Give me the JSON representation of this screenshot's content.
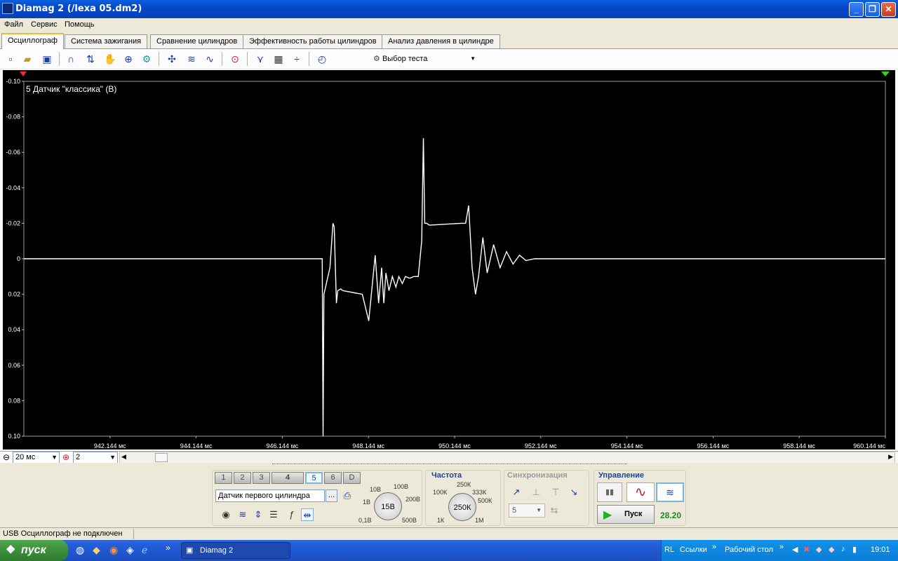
{
  "window": {
    "title": "Diamag 2 (/lexa 05.dm2)"
  },
  "menu": [
    "Файл",
    "Сервис",
    "Помощь"
  ],
  "tabs": [
    {
      "label": "Осциллограф",
      "active": true
    },
    {
      "label": "Система зажигания",
      "active": false
    },
    {
      "label": "Сравнение цилиндров",
      "active": false
    },
    {
      "label": "Эффективность работы цилиндров",
      "active": false
    },
    {
      "label": "Анализ давления в цилиндре",
      "active": false
    }
  ],
  "toolbar": {
    "test_select": "Выбор теста",
    "icons": [
      "new-file-icon",
      "open-file-icon",
      "save-icon",
      "signal-icon",
      "cursor-icon",
      "hand-icon",
      "zoom-icon",
      "filter-icon",
      "scale-icon",
      "waves-icon",
      "spectrum-icon",
      "auto-icon",
      "markers-icon",
      "grid-icon",
      "split-icon",
      "stopwatch-icon"
    ]
  },
  "scope": {
    "channel_label": "5 Датчик \"классика\" (В)",
    "y_ticks": [
      "-0.10",
      "-0.08",
      "-0.06",
      "-0.04",
      "-0.02",
      "0",
      "0.02",
      "0.04",
      "0.06",
      "0.08",
      "0.10"
    ],
    "x_ticks": [
      "942.144 мс",
      "944.144 мс",
      "946.144 мс",
      "948.144 мс",
      "950.144 мс",
      "952.144 мс",
      "954.144 мс",
      "956.144 мс",
      "958.144 мс",
      "960.144 мс"
    ],
    "colors": {
      "background": "#000000",
      "grid": "#3a3a3a",
      "trace": "#ffffff",
      "axis_text": "#ffffff"
    }
  },
  "chart_data": {
    "type": "line",
    "title": "5 Датчик \"классика\" (В)",
    "xlabel": "",
    "ylabel": "",
    "xlim": [
      940.144,
      960.144
    ],
    "ylim": [
      0.1,
      -0.1
    ],
    "grid": true,
    "x": [
      940.144,
      946.15,
      947.07,
      947.09,
      947.11,
      947.13,
      947.25,
      947.32,
      947.35,
      947.4,
      947.43,
      947.5,
      947.55,
      948.0,
      948.15,
      948.3,
      948.38,
      948.45,
      948.5,
      948.55,
      948.62,
      948.7,
      948.78,
      948.85,
      948.93,
      949.0,
      949.1,
      949.2,
      949.3,
      949.38,
      949.42,
      949.45,
      949.5,
      949.55,
      949.6,
      950.3,
      950.4,
      950.47,
      950.55,
      950.63,
      950.7,
      950.8,
      950.9,
      951.05,
      951.2,
      951.35,
      951.5,
      951.65,
      951.8,
      952.0,
      952.3,
      960.144
    ],
    "y": [
      0.0,
      0.0,
      0.0,
      0.1,
      0.02,
      0.018,
      0.005,
      -0.02,
      -0.018,
      0.025,
      0.018,
      0.017,
      0.018,
      0.02,
      0.035,
      -0.002,
      0.025,
      0.005,
      0.025,
      0.008,
      0.018,
      0.01,
      0.016,
      0.01,
      0.014,
      0.01,
      0.011,
      0.01,
      0.01,
      -0.01,
      -0.068,
      -0.02,
      -0.02,
      -0.019,
      -0.019,
      -0.02,
      -0.02,
      -0.03,
      0.005,
      0.02,
      0.01,
      -0.012,
      0.008,
      -0.008,
      0.005,
      -0.004,
      0.003,
      -0.002,
      0.001,
      0.0,
      0.0,
      0.0
    ],
    "series": [
      {
        "name": "5 Датчик \"классика\" (В)"
      }
    ]
  },
  "scrollrow": {
    "timebase": "20 мс",
    "channel_count": "2"
  },
  "channels": {
    "buttons": [
      "1",
      "2",
      "3",
      "4",
      "5",
      "6",
      "D"
    ],
    "active": "5",
    "sensor": "Датчик первого цилиндра",
    "more": "...",
    "volt_knob": "15В",
    "volt_labels": [
      "10В",
      "100В",
      "1В",
      "200В",
      "0,1В",
      "500В"
    ]
  },
  "frequency": {
    "title": "Частота",
    "knob": "250К",
    "labels": [
      "250К",
      "100К",
      "333К",
      "500К",
      "1К",
      "1М"
    ]
  },
  "sync": {
    "title": "Синхронизация",
    "value": "5"
  },
  "control": {
    "title": "Управление",
    "start_label": "Пуск",
    "time_value": "28.20"
  },
  "status": {
    "text": "USB Осциллограф не подключен"
  },
  "taskbar": {
    "start": "пуск",
    "task": "Diamag 2",
    "lang": "RL",
    "links": "Ссылки",
    "desktop": "Рабочий стол",
    "clock": "19:01"
  }
}
